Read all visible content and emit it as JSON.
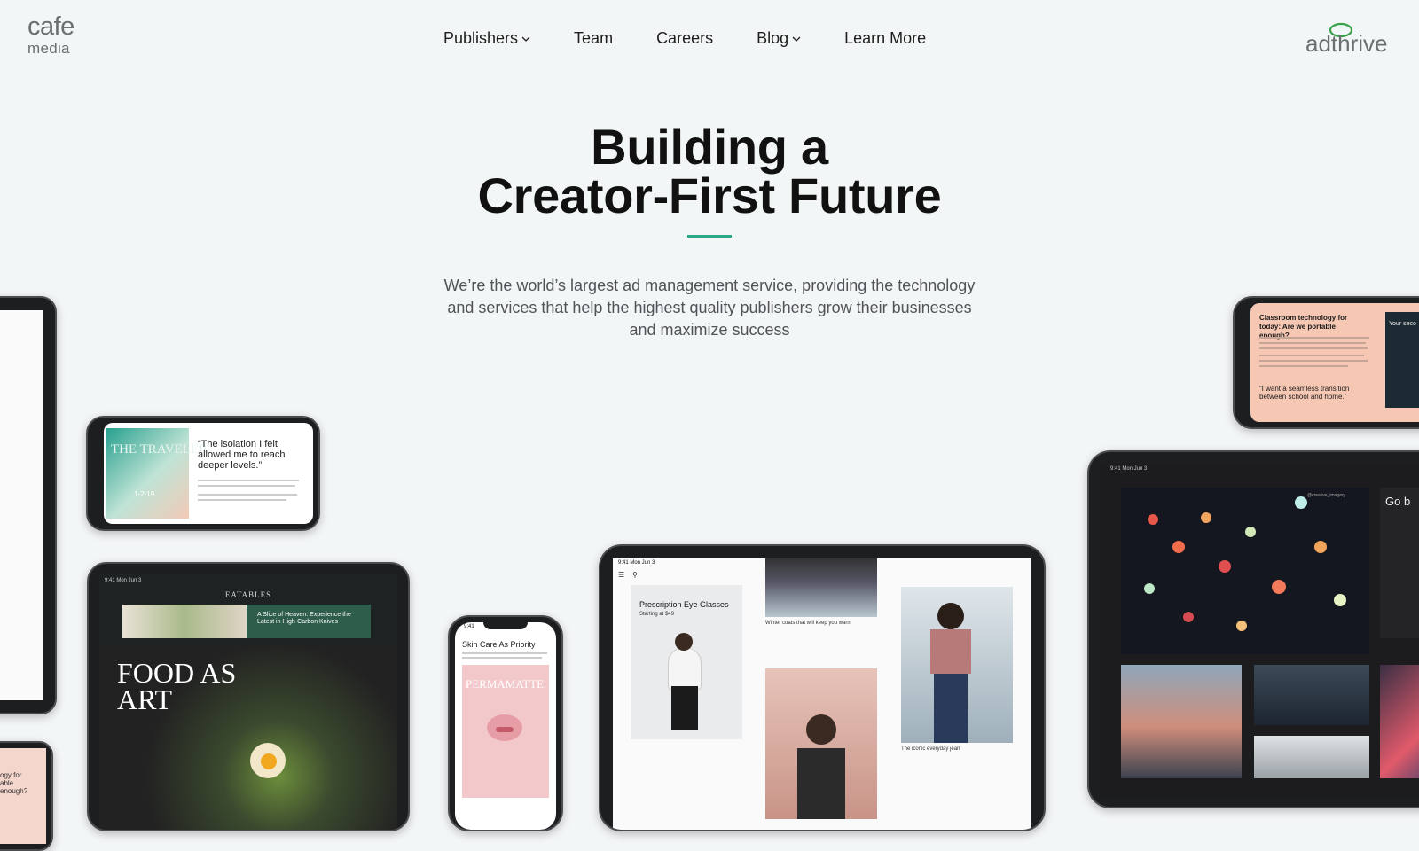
{
  "header": {
    "logo_left": {
      "line1": "cafe",
      "line2": "media"
    },
    "nav": [
      {
        "label": "Publishers",
        "has_dropdown": true
      },
      {
        "label": "Team",
        "has_dropdown": false
      },
      {
        "label": "Careers",
        "has_dropdown": false
      },
      {
        "label": "Blog",
        "has_dropdown": true
      },
      {
        "label": "Learn More",
        "has_dropdown": false
      }
    ],
    "logo_right": "adthrive"
  },
  "hero": {
    "title_line1": "Building a",
    "title_line2": "Creator-First Future",
    "subtitle": "We’re the world’s largest ad management service, providing the technology and services that help the highest quality publishers grow their businesses and maximize success"
  },
  "devices": {
    "phone_traveler": {
      "title": "THE TRAVELER",
      "quote": "“The isolation I felt allowed me to reach deeper levels.”",
      "date": "1-2-19"
    },
    "tablet_food": {
      "brand": "EATABLES",
      "ad_text": "A Slice of Heaven: Experience the Latest in High-Carbon Knives",
      "headline": "FOOD AS ART",
      "status": "9:41  Mon Jun 3"
    },
    "phone_skin": {
      "status": "9:41",
      "title": "Skin Care As Priority",
      "ad_title": "PERMAMATTE"
    },
    "tablet_fashion": {
      "status": "9:41  Mon Jun 3",
      "card1_title": "Prescription Eye Glasses",
      "card1_sub": "Starting at $49",
      "card2_caption": "Winter coats that will keep you warm",
      "card3_caption": "The iconic everyday jean"
    },
    "phone_classroom": {
      "title": "Classroom technology for today: Are we portable enough?",
      "quote": "“I want a seamless transition between school and home.”",
      "side": "Your seco"
    },
    "tablet_photo": {
      "status": "9:41  Mon Jun 3",
      "handle": "@creative_imagery",
      "side": "Go b"
    },
    "phone_bottom_left": {
      "text": "ogy for able enough?"
    }
  },
  "colors": {
    "accent": "#2aa88a",
    "background": "#f3f6f7",
    "nav_text": "#1e1e1e",
    "body_text": "#505357"
  }
}
